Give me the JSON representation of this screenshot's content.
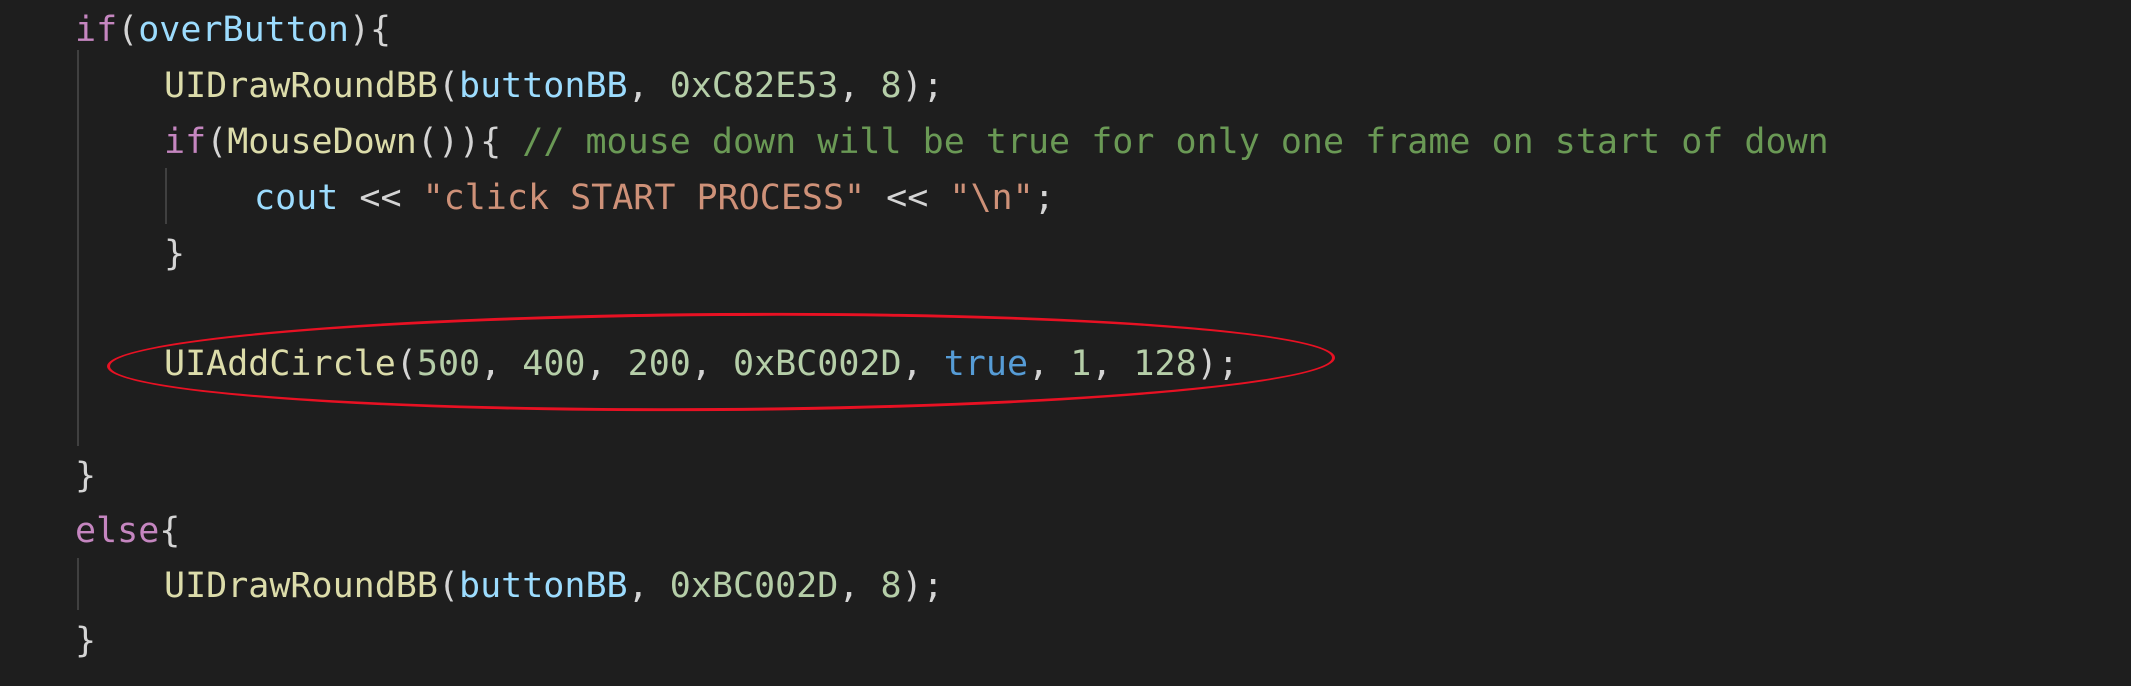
{
  "code": {
    "line1": {
      "kw_if": "if",
      "paren_open": "(",
      "var": "overButton",
      "paren_close_brace": "){"
    },
    "line2": {
      "fn": "UIDrawRoundBB",
      "paren_open": "(",
      "var": "buttonBB",
      "sep1": ", ",
      "num1": "0xC82E53",
      "sep2": ", ",
      "num2": "8",
      "end": ");"
    },
    "line3": {
      "kw_if": "if",
      "paren_open": "(",
      "fn": "MouseDown",
      "paren_rest": "()){",
      "space": " ",
      "comment": "// mouse down will be true for only one frame on start of down"
    },
    "line4": {
      "var": "cout",
      "op1": " << ",
      "str1": "\"click START PROCESS\"",
      "op2": " << ",
      "str2": "\"\\n\"",
      "end": ";"
    },
    "line5": {
      "brace": "}"
    },
    "line7": {
      "fn": "UIAddCircle",
      "paren_open": "(",
      "num1": "500",
      "sep1": ", ",
      "num2": "400",
      "sep2": ", ",
      "num3": "200",
      "sep3": ", ",
      "num4": "0xBC002D",
      "sep4": ", ",
      "bool": "true",
      "sep5": ", ",
      "num5": "1",
      "sep6": ", ",
      "num6": "128",
      "end": ");"
    },
    "line9": {
      "brace": "}"
    },
    "line10": {
      "kw_else": "else",
      "brace": "{"
    },
    "line11": {
      "fn": "UIDrawRoundBB",
      "paren_open": "(",
      "var": "buttonBB",
      "sep1": ", ",
      "num1": "0xBC002D",
      "sep2": ", ",
      "num2": "8",
      "end": ");"
    },
    "line12": {
      "brace": "}"
    }
  },
  "colors": {
    "background": "#1e1e1e",
    "keyword": "#c586c0",
    "function": "#dcdcaa",
    "variable": "#9cdcfe",
    "number": "#b5cea8",
    "string": "#ce9178",
    "boolean": "#569cd6",
    "comment": "#6a9955",
    "punctuation": "#d4d4d4",
    "annotation": "#e81123"
  }
}
